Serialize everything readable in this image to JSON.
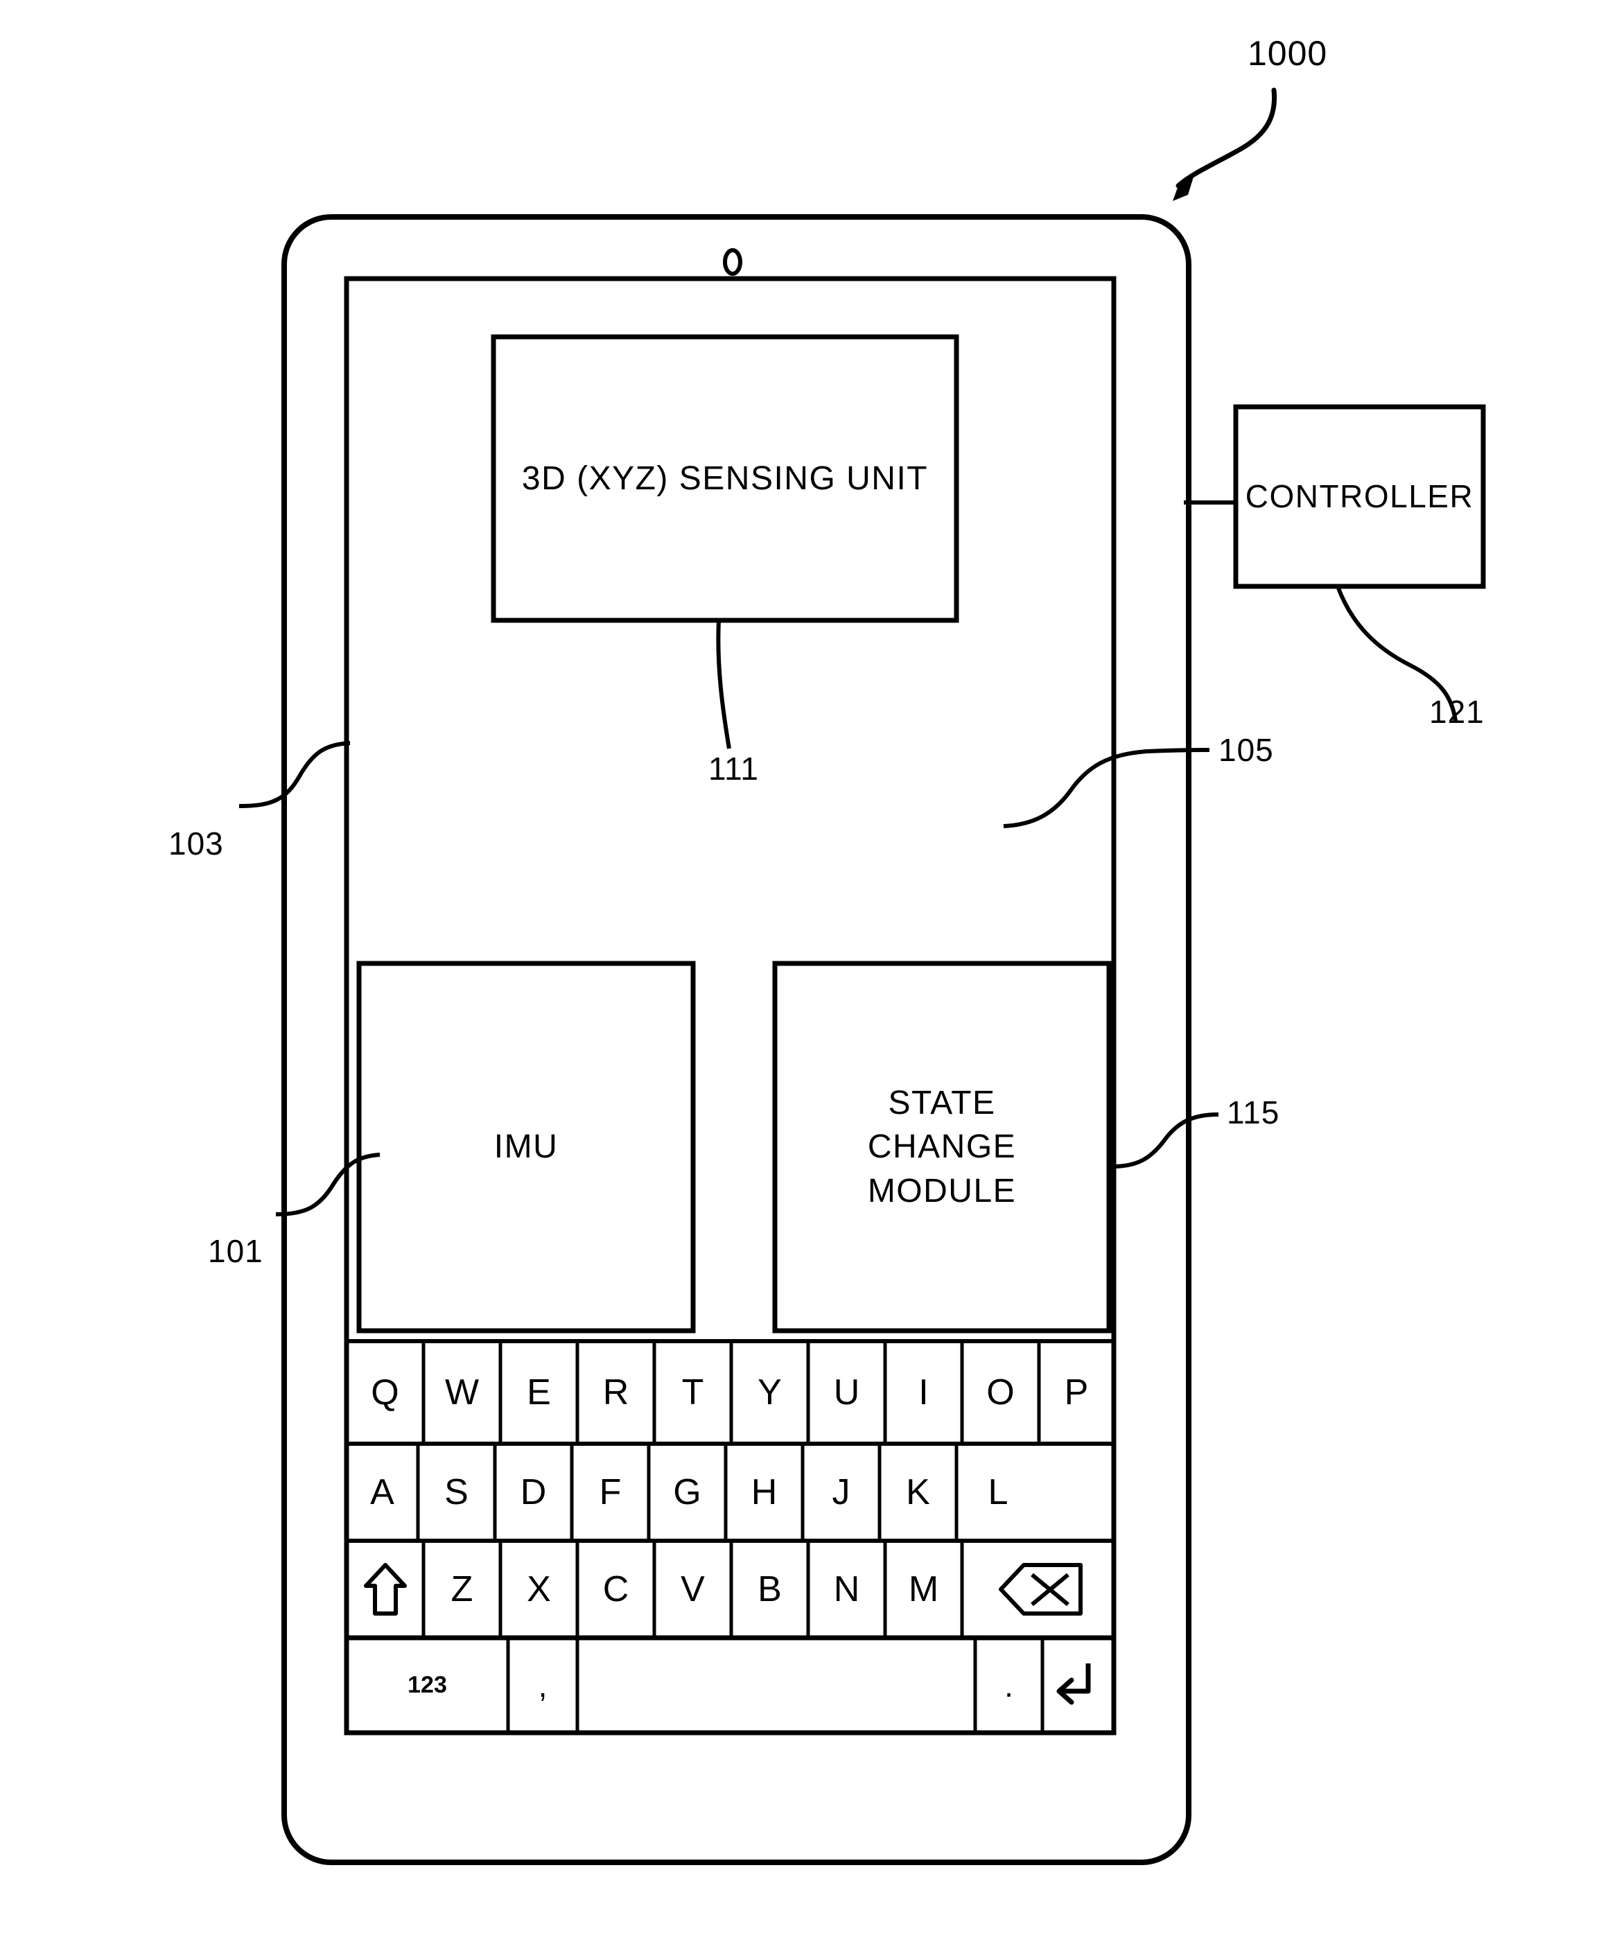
{
  "figure": {
    "number": "1000",
    "callout_arrow": "curved-arrow-down-left"
  },
  "device": {
    "name": "mobile-device",
    "camera_icon": "camera-dot",
    "reference_bezel": "103",
    "reference_body": "101",
    "screen": {
      "reference": "105"
    }
  },
  "blocks": [
    {
      "id": "sensing-unit",
      "label": "3D (XYZ) SENSING UNIT",
      "reference": "111"
    },
    {
      "id": "imu",
      "label": "IMU",
      "reference": "101"
    },
    {
      "id": "state-change-module",
      "label_lines": [
        "STATE",
        "CHANGE",
        "MODULE"
      ],
      "reference": "115"
    },
    {
      "id": "controller",
      "label": "CONTROLLER",
      "reference": "121"
    }
  ],
  "references": {
    "r1000": "1000",
    "r103": "103",
    "r101": "101",
    "r111": "111",
    "r105": "105",
    "r115": "115",
    "r121": "121"
  },
  "keyboard": {
    "rows": [
      {
        "id": "row-qwerty",
        "keys": [
          {
            "label": "Q",
            "kind": "letter"
          },
          {
            "label": "W",
            "kind": "letter"
          },
          {
            "label": "E",
            "kind": "letter"
          },
          {
            "label": "R",
            "kind": "letter"
          },
          {
            "label": "T",
            "kind": "letter"
          },
          {
            "label": "Y",
            "kind": "letter"
          },
          {
            "label": "U",
            "kind": "letter"
          },
          {
            "label": "I",
            "kind": "letter"
          },
          {
            "label": "O",
            "kind": "letter"
          },
          {
            "label": "P",
            "kind": "letter"
          }
        ]
      },
      {
        "id": "row-asdf",
        "keys": [
          {
            "label": "A",
            "kind": "letter"
          },
          {
            "label": "S",
            "kind": "letter"
          },
          {
            "label": "D",
            "kind": "letter"
          },
          {
            "label": "F",
            "kind": "letter"
          },
          {
            "label": "G",
            "kind": "letter"
          },
          {
            "label": "H",
            "kind": "letter"
          },
          {
            "label": "J",
            "kind": "letter"
          },
          {
            "label": "K",
            "kind": "letter"
          },
          {
            "label": "L",
            "kind": "letter"
          }
        ]
      },
      {
        "id": "row-zxcv",
        "keys": [
          {
            "label": "⇧",
            "kind": "shift",
            "icon": "shift-arrow-icon"
          },
          {
            "label": "Z",
            "kind": "letter"
          },
          {
            "label": "X",
            "kind": "letter"
          },
          {
            "label": "C",
            "kind": "letter"
          },
          {
            "label": "V",
            "kind": "letter"
          },
          {
            "label": "B",
            "kind": "letter"
          },
          {
            "label": "N",
            "kind": "letter"
          },
          {
            "label": "M",
            "kind": "letter"
          },
          {
            "label": "⌫",
            "kind": "backspace",
            "icon": "backspace-icon"
          }
        ]
      },
      {
        "id": "row-bottom",
        "keys": [
          {
            "label": "123",
            "kind": "numeric-mode"
          },
          {
            "label": ",",
            "kind": "comma"
          },
          {
            "label": "",
            "kind": "space"
          },
          {
            "label": ".",
            "kind": "period"
          },
          {
            "label": "↵",
            "kind": "enter",
            "icon": "enter-icon"
          }
        ]
      }
    ]
  }
}
